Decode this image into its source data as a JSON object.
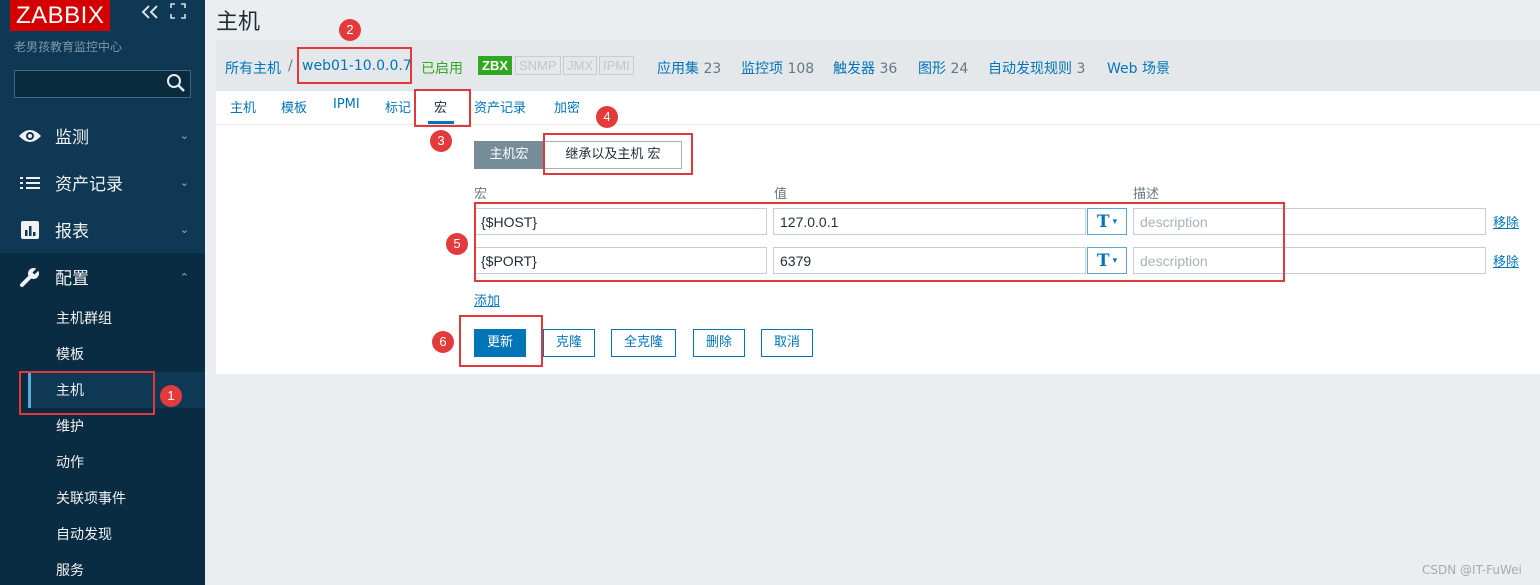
{
  "sidebar": {
    "logo": "ZABBIX",
    "collapse_icon": "double-chevron-left-icon",
    "expand_icon": "kiosk-icon",
    "org_name": "老男孩教育监控中心",
    "search": {
      "value": "",
      "placeholder": ""
    },
    "menu": [
      {
        "label": "监测",
        "icon": "eye-icon",
        "expanded": false
      },
      {
        "label": "资产记录",
        "icon": "list-icon",
        "expanded": false
      },
      {
        "label": "报表",
        "icon": "bar-chart-icon",
        "expanded": false
      },
      {
        "label": "配置",
        "icon": "wrench-icon",
        "expanded": true
      }
    ],
    "submenu": [
      "主机群组",
      "模板",
      "主机",
      "维护",
      "动作",
      "关联项事件",
      "自动发现",
      "服务"
    ]
  },
  "page_title": "主机",
  "breadcrumb": {
    "all_hosts": "所有主机",
    "separator": "/",
    "current_host": "web01-10.0.0.7",
    "status": "已启用",
    "availability": [
      "ZBX",
      "SNMP",
      "JMX",
      "IPMI"
    ],
    "links": [
      {
        "label": "应用集",
        "count": "23"
      },
      {
        "label": "监控项",
        "count": "108"
      },
      {
        "label": "触发器",
        "count": "36"
      },
      {
        "label": "图形",
        "count": "24"
      },
      {
        "label": "自动发现规则",
        "count": "3"
      },
      {
        "label": "Web 场景",
        "count": ""
      }
    ]
  },
  "tabs": [
    "主机",
    "模板",
    "IPMI",
    "标记",
    "宏",
    "资产记录",
    "加密"
  ],
  "active_tab": "宏",
  "macro_toggle": {
    "host": "主机宏",
    "inherited": "继承以及主机 宏"
  },
  "columns": {
    "macro": "宏",
    "value": "值",
    "description": "描述"
  },
  "macros": [
    {
      "macro": "{$HOST}",
      "value": "127.0.0.1",
      "type": "T",
      "description": "",
      "description_placeholder": "description",
      "remove": "移除"
    },
    {
      "macro": "{$PORT}",
      "value": "6379",
      "type": "T",
      "description": "",
      "description_placeholder": "description",
      "remove": "移除"
    }
  ],
  "add_label": "添加",
  "buttons": {
    "update": "更新",
    "clone": "克隆",
    "full_clone": "全克隆",
    "delete": "删除",
    "cancel": "取消"
  },
  "annotations": [
    "1",
    "2",
    "3",
    "4",
    "5",
    "6"
  ],
  "watermark": "CSDN @IT-FuWei",
  "colors": {
    "sidebar_bg": "#0e3853",
    "logo_bg": "#d40000",
    "link": "#0275b8",
    "enabled": "#31a821",
    "annotation_red": "#e0393b",
    "primary_button": "#0275b8"
  }
}
